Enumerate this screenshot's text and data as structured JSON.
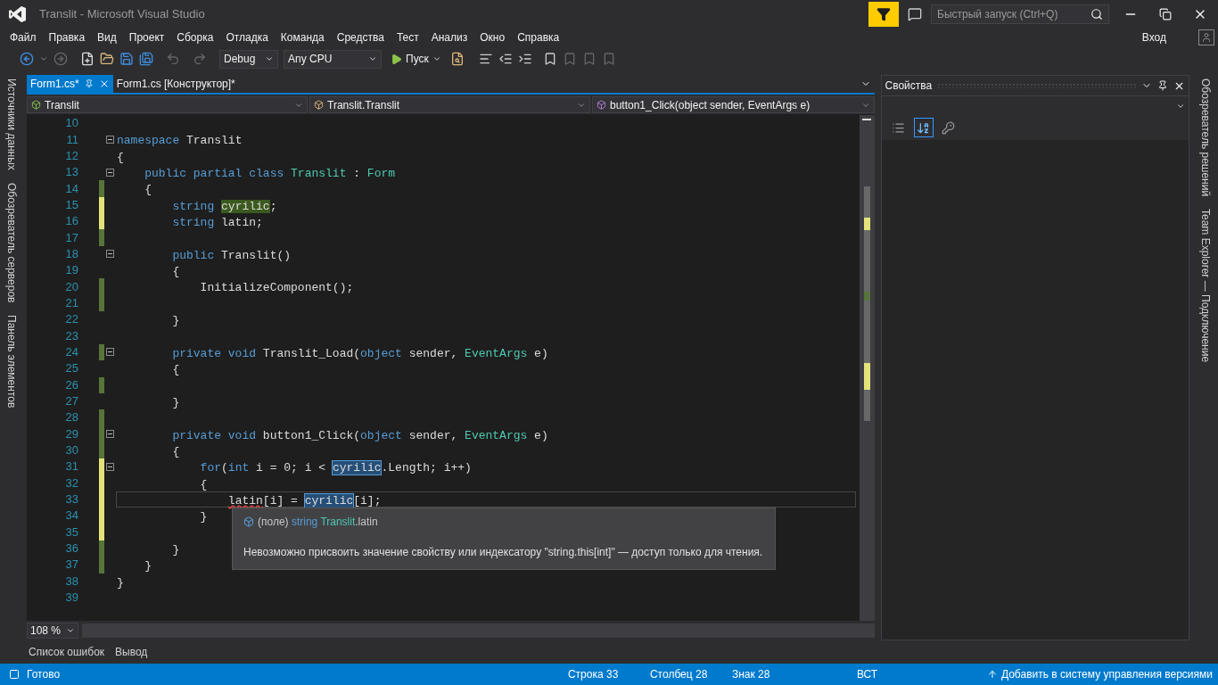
{
  "window": {
    "title": "Translit - Microsoft Visual Studio"
  },
  "quick_launch": {
    "placeholder": "Быстрый запуск (Ctrl+Q)"
  },
  "menu": [
    "Файл",
    "Правка",
    "Вид",
    "Проект",
    "Сборка",
    "Отладка",
    "Команда",
    "Средства",
    "Тест",
    "Анализ",
    "Окно",
    "Справка"
  ],
  "sign_in": "Вход",
  "toolbar": {
    "configuration": "Debug",
    "platform": "Any CPU",
    "start": "Пуск"
  },
  "left_tabs": [
    "Источники данных",
    "Обозреватель серверов",
    "Панель элементов"
  ],
  "right_tabs": [
    "Обозреватель решений",
    "Team Explorer — Подключение"
  ],
  "document_tabs": [
    {
      "label": "Form1.cs*",
      "selected": true
    },
    {
      "label": "Form1.cs [Конструктор]*",
      "selected": false
    }
  ],
  "navigation": [
    "Translit",
    "Translit.Translit",
    "button1_Click(object sender, EventArgs e)"
  ],
  "code": [
    {
      "number": "10",
      "saved_change": false,
      "unsaved_change": false,
      "fold": false,
      "current": false
    },
    {
      "number": "11",
      "saved_change": false,
      "unsaved_change": false,
      "fold": true,
      "current": false,
      "tokens": [
        {
          "kind": "kw",
          "text": "namespace"
        },
        {
          "kind": "plain",
          "text": " Translit"
        }
      ]
    },
    {
      "number": "12",
      "saved_change": false,
      "unsaved_change": false,
      "fold": false,
      "current": false,
      "tokens": [
        {
          "kind": "plain",
          "text": "{"
        }
      ]
    },
    {
      "number": "13",
      "saved_change": false,
      "unsaved_change": false,
      "fold": true,
      "current": false,
      "tokens": [
        {
          "kind": "kw",
          "text": "    public partial class"
        },
        {
          "kind": "type",
          "text": " Translit"
        },
        {
          "kind": "plain",
          "text": " : "
        },
        {
          "kind": "type",
          "text": "Form"
        }
      ]
    },
    {
      "number": "14",
      "saved_change": true,
      "unsaved_change": false,
      "fold": false,
      "current": false,
      "tokens": [
        {
          "kind": "plain",
          "text": "    {"
        }
      ]
    },
    {
      "number": "15",
      "saved_change": false,
      "unsaved_change": true,
      "fold": false,
      "current": false,
      "tokens": [
        {
          "kind": "kw",
          "text": "        string "
        },
        {
          "kind": "ref",
          "text": "cyrilic"
        },
        {
          "kind": "plain",
          "text": ";"
        }
      ]
    },
    {
      "number": "16",
      "saved_change": false,
      "unsaved_change": true,
      "fold": false,
      "current": false,
      "tokens": [
        {
          "kind": "kw",
          "text": "        string"
        },
        {
          "kind": "plain",
          "text": " latin;"
        }
      ]
    },
    {
      "number": "17",
      "saved_change": true,
      "unsaved_change": false,
      "fold": false,
      "current": false
    },
    {
      "number": "18",
      "saved_change": false,
      "unsaved_change": false,
      "fold": true,
      "current": false,
      "tokens": [
        {
          "kind": "kw",
          "text": "        public"
        },
        {
          "kind": "plain",
          "text": " Translit()"
        }
      ]
    },
    {
      "number": "19",
      "saved_change": false,
      "unsaved_change": false,
      "fold": false,
      "current": false,
      "tokens": [
        {
          "kind": "plain",
          "text": "        {"
        }
      ]
    },
    {
      "number": "20",
      "saved_change": true,
      "unsaved_change": false,
      "fold": false,
      "current": false,
      "tokens": [
        {
          "kind": "plain",
          "text": "            InitializeComponent();"
        }
      ]
    },
    {
      "number": "21",
      "saved_change": true,
      "unsaved_change": false,
      "fold": false,
      "current": false
    },
    {
      "number": "22",
      "saved_change": false,
      "unsaved_change": false,
      "fold": false,
      "current": false,
      "tokens": [
        {
          "kind": "plain",
          "text": "        }"
        }
      ]
    },
    {
      "number": "23",
      "saved_change": false,
      "unsaved_change": false,
      "fold": false,
      "current": false
    },
    {
      "number": "24",
      "saved_change": true,
      "unsaved_change": false,
      "fold": true,
      "current": false,
      "tokens": [
        {
          "kind": "kw",
          "text": "        private void"
        },
        {
          "kind": "plain",
          "text": " Translit_Load("
        },
        {
          "kind": "kw",
          "text": "object"
        },
        {
          "kind": "plain",
          "text": " sender, "
        },
        {
          "kind": "type",
          "text": "EventArgs"
        },
        {
          "kind": "plain",
          "text": " e)"
        }
      ]
    },
    {
      "number": "25",
      "saved_change": false,
      "unsaved_change": false,
      "fold": false,
      "current": false,
      "tokens": [
        {
          "kind": "plain",
          "text": "        {"
        }
      ]
    },
    {
      "number": "26",
      "saved_change": true,
      "unsaved_change": false,
      "fold": false,
      "current": false
    },
    {
      "number": "27",
      "saved_change": false,
      "unsaved_change": false,
      "fold": false,
      "current": false,
      "tokens": [
        {
          "kind": "plain",
          "text": "        }"
        }
      ]
    },
    {
      "number": "28",
      "saved_change": true,
      "unsaved_change": false,
      "fold": false,
      "current": false
    },
    {
      "number": "29",
      "saved_change": true,
      "unsaved_change": false,
      "fold": true,
      "current": false,
      "tokens": [
        {
          "kind": "kw",
          "text": "        private void"
        },
        {
          "kind": "plain",
          "text": " button1_Click("
        },
        {
          "kind": "kw",
          "text": "object"
        },
        {
          "kind": "plain",
          "text": " sender, "
        },
        {
          "kind": "type",
          "text": "EventArgs"
        },
        {
          "kind": "plain",
          "text": " e)"
        }
      ]
    },
    {
      "number": "30",
      "saved_change": true,
      "unsaved_change": false,
      "fold": false,
      "current": false,
      "tokens": [
        {
          "kind": "plain",
          "text": "        {"
        }
      ]
    },
    {
      "number": "31",
      "saved_change": false,
      "unsaved_change": true,
      "fold": true,
      "current": false,
      "tokens": [
        {
          "kind": "kw",
          "text": "            for"
        },
        {
          "kind": "plain",
          "text": "("
        },
        {
          "kind": "kw",
          "text": "int"
        },
        {
          "kind": "plain",
          "text": " i = 0; i < "
        },
        {
          "kind": "sel",
          "text": "cyrilic"
        },
        {
          "kind": "plain",
          "text": ".Length; i++)"
        }
      ]
    },
    {
      "number": "32",
      "saved_change": false,
      "unsaved_change": true,
      "fold": false,
      "current": false,
      "tokens": [
        {
          "kind": "plain",
          "text": "            {"
        }
      ]
    },
    {
      "number": "33",
      "saved_change": false,
      "unsaved_change": true,
      "fold": false,
      "current": true,
      "tokens": [
        {
          "kind": "err",
          "text": "                latin"
        },
        {
          "kind": "plain",
          "text": "[i] = "
        },
        {
          "kind": "sel",
          "text": "cyrilic"
        },
        {
          "kind": "plain",
          "text": "[i];"
        }
      ]
    },
    {
      "number": "34",
      "saved_change": false,
      "unsaved_change": true,
      "fold": false,
      "current": false,
      "tokens": [
        {
          "kind": "plain",
          "text": "            }"
        }
      ]
    },
    {
      "number": "35",
      "saved_change": false,
      "unsaved_change": true,
      "fold": false,
      "current": false
    },
    {
      "number": "36",
      "saved_change": true,
      "unsaved_change": false,
      "fold": false,
      "current": false,
      "tokens": [
        {
          "kind": "plain",
          "text": "        }"
        }
      ]
    },
    {
      "number": "37",
      "saved_change": true,
      "unsaved_change": false,
      "fold": false,
      "current": false,
      "tokens": [
        {
          "kind": "plain",
          "text": "    }"
        }
      ]
    },
    {
      "number": "38",
      "saved_change": false,
      "unsaved_change": false,
      "fold": false,
      "current": false,
      "tokens": [
        {
          "kind": "plain",
          "text": "}"
        }
      ]
    },
    {
      "number": "39",
      "saved_change": false,
      "unsaved_change": false,
      "fold": false,
      "current": false
    }
  ],
  "tooltip": {
    "signature": [
      {
        "kind": "plain",
        "text": "(поле) "
      },
      {
        "kind": "kw",
        "text": "string"
      },
      {
        "kind": "type",
        "text": " Translit"
      },
      {
        "kind": "plain",
        "text": ".latin"
      }
    ],
    "message": "Невозможно присвоить значение свойству или индексатору \"string.this[int]\" — доступ только для чтения."
  },
  "zoom": "108 %",
  "properties": {
    "title": "Свойства",
    "buttons": [
      {
        "kind": "categorized",
        "selected": false
      },
      {
        "kind": "alphabetical",
        "selected": true
      },
      {
        "kind": "pages",
        "selected": false
      }
    ]
  },
  "bottom_tabs": [
    "Список ошибок",
    "Вывод"
  ],
  "status_bar": {
    "state": "Готово",
    "line": "Строка 33",
    "column": "Столбец 28",
    "char": "Знак 28",
    "mode": "ВСТ",
    "source_control": "Добавить в систему управления версиями"
  }
}
